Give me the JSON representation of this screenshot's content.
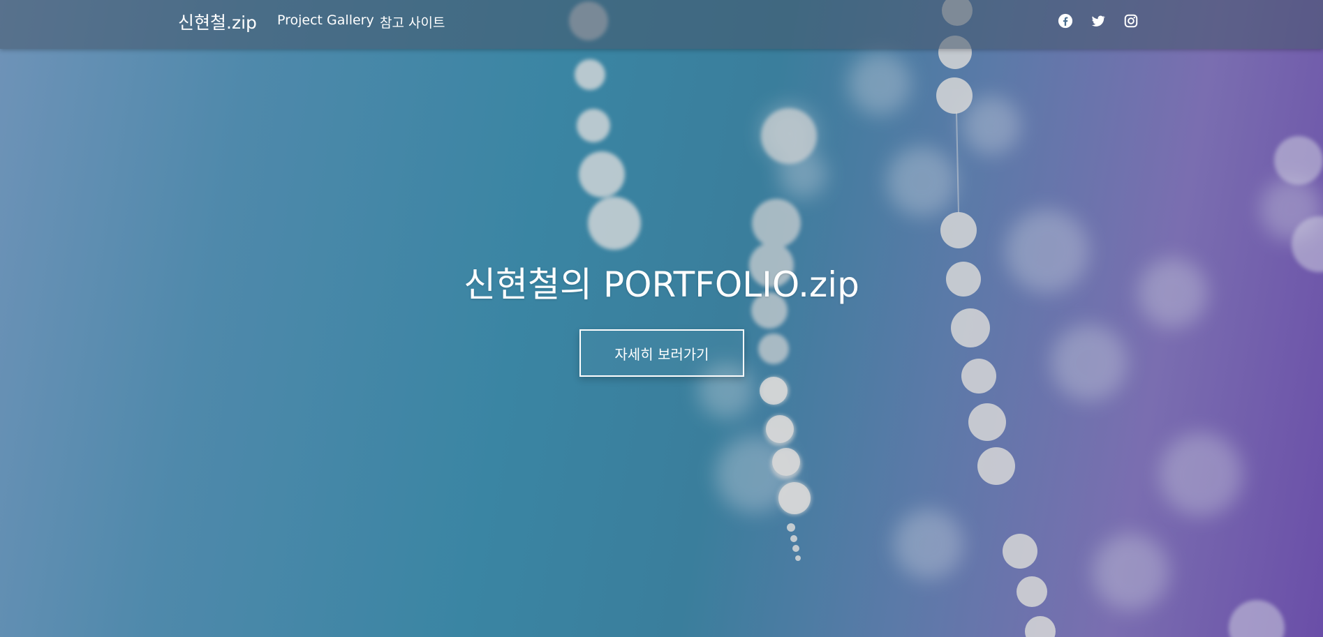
{
  "navbar": {
    "brand": "신현철.zip",
    "links": [
      {
        "label": "Project Gallery"
      },
      {
        "label": "참고 사이트"
      }
    ],
    "social_icons": [
      "facebook-icon",
      "twitter-icon",
      "instagram-icon"
    ]
  },
  "hero": {
    "title": "신현철의 PORTFOLIO.zip",
    "cta_label": "자세히 보러가기"
  },
  "colors": {
    "navbar_bg": "#46556980",
    "hero_teal": "#3a85a3",
    "hero_purple": "#6a4ea8",
    "text": "#ffffff"
  }
}
